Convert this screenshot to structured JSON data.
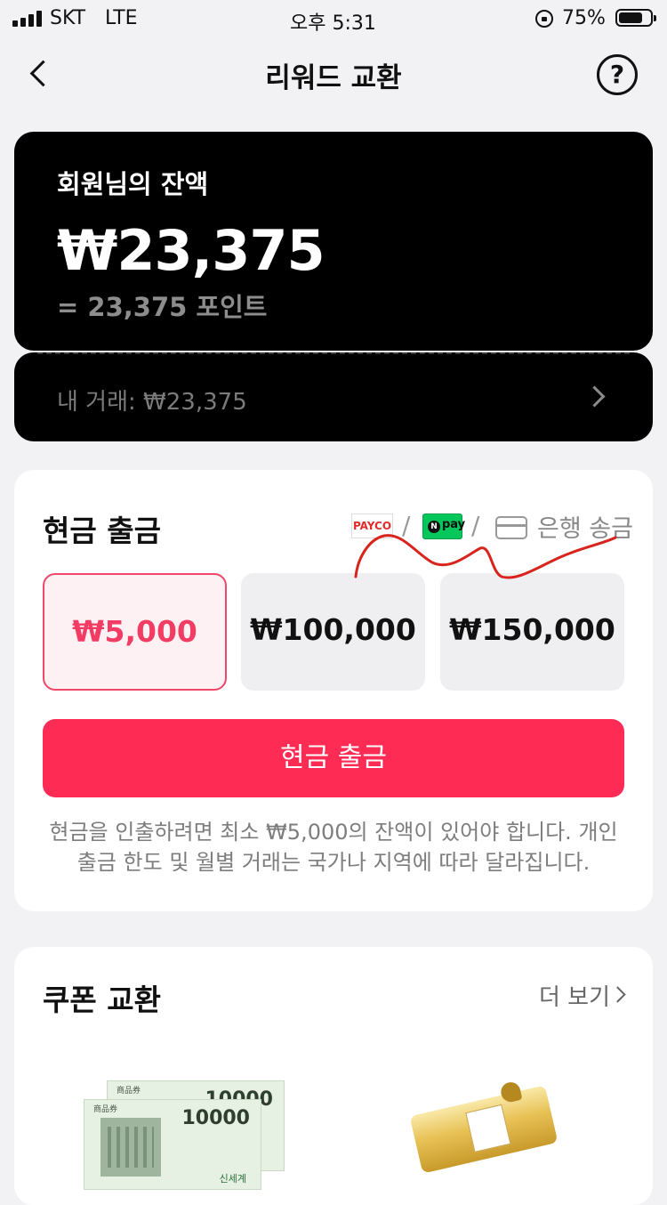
{
  "status_bar": {
    "carrier": "SKT",
    "network": "LTE",
    "time": "오후 5:31",
    "battery_percent_text": "75%",
    "battery_level": 0.75
  },
  "nav": {
    "title": "리워드 교환",
    "back_icon": "chevron-left-icon",
    "help_icon": "question-circle-icon",
    "help_glyph": "?"
  },
  "balance": {
    "label": "회원님의 잔액",
    "amount": "₩23,375",
    "points": "= 23,375 포인트",
    "transactions": "내 거래: ₩23,375"
  },
  "cash_withdrawal": {
    "title": "현금 출금",
    "payco_label": "PAYCO",
    "npay_label": "pay",
    "npay_glyph": "N",
    "separator": "/",
    "bank_transfer": "은행 송금",
    "options": [
      "₩5,000",
      "₩100,000",
      "₩150,000"
    ],
    "selected_option": "₩5,000",
    "button_label": "현금 출금",
    "notice": "현금을 인출하려면 최소 ₩5,000의 잔액이 있어야 합니다. 개인 출금 한도 및 월별 거래는 국가나 지역에 따라 달라집니다."
  },
  "coupon": {
    "title": "쿠폰 교환",
    "more": "더 보기",
    "voucher_label": "商品券",
    "voucher_value": "10000",
    "voucher_brand": "신세계"
  },
  "colors": {
    "accent": "#fe2c55",
    "selected_text": "#f23c63",
    "card_black": "#000000",
    "background": "#f2f2f4"
  }
}
